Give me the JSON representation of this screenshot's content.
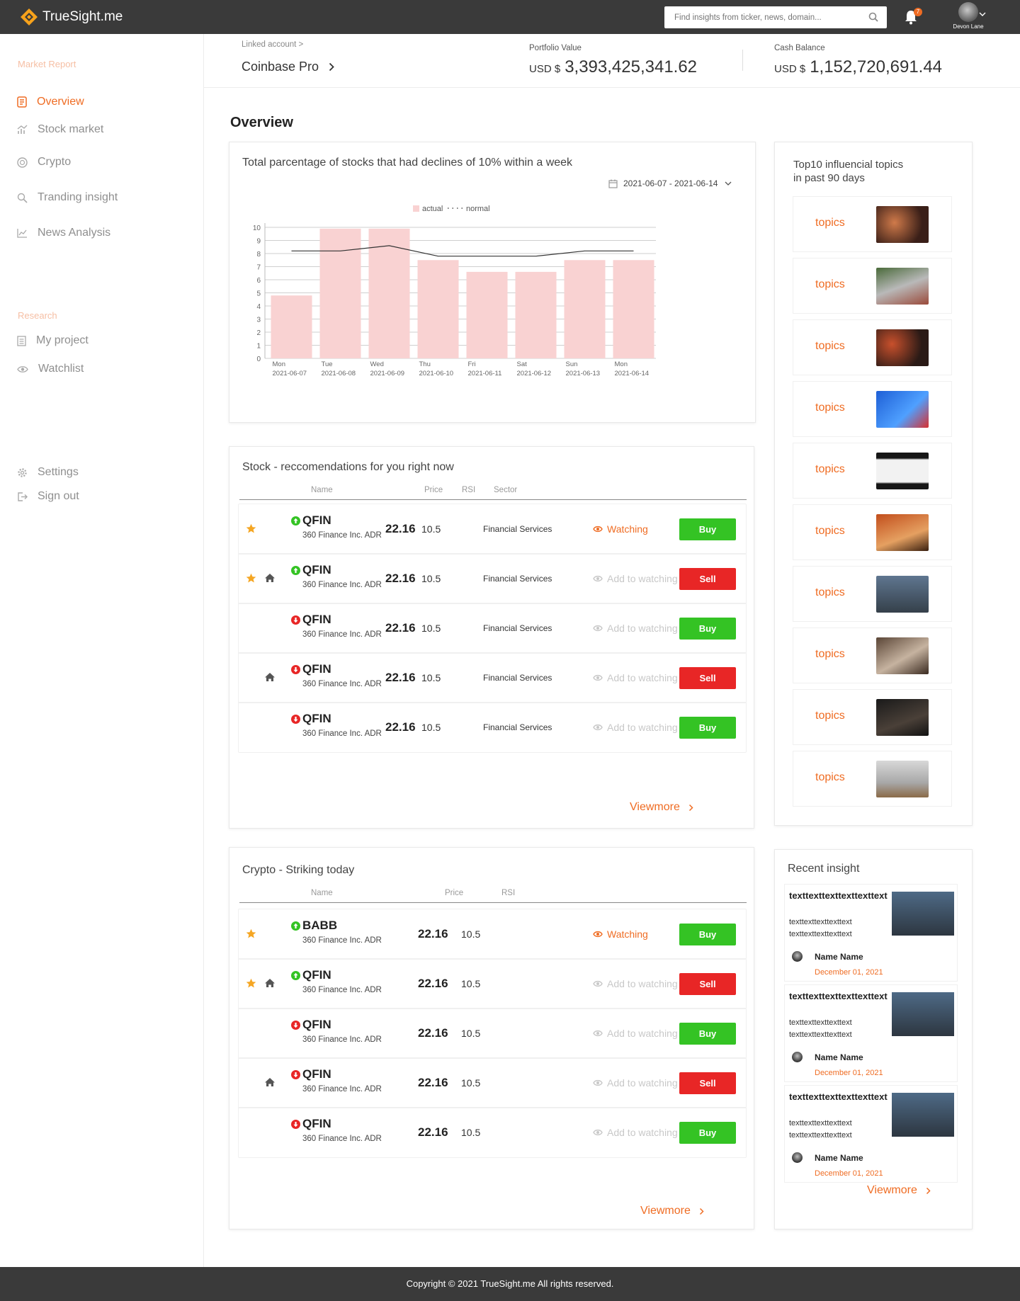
{
  "app": {
    "name": "TrueSight.me"
  },
  "header": {
    "search_placeholder": "Find insights from ticker, news, domain...",
    "notification_count": "7",
    "user_name": "Devon Lane"
  },
  "sidebar": {
    "market_label": "Market Report",
    "market_items": [
      {
        "label": "Overview",
        "icon": "overview-icon",
        "active": true
      },
      {
        "label": "Stock market",
        "icon": "stock-chart-icon"
      },
      {
        "label": "Crypto",
        "icon": "crypto-icon"
      },
      {
        "label": "Tranding insight",
        "icon": "search-insight-icon"
      },
      {
        "label": "News Analysis",
        "icon": "line-chart-icon"
      }
    ],
    "research_label": "Research",
    "research_items": [
      {
        "label": "My project",
        "icon": "project-icon"
      },
      {
        "label": "Watchlist",
        "icon": "eye-icon"
      }
    ],
    "bottom_items": [
      {
        "label": "Settings",
        "icon": "gear-icon"
      },
      {
        "label": "Sign out",
        "icon": "sign-out-icon"
      }
    ]
  },
  "account": {
    "linked_label": "Linked account >",
    "linked_value": "Coinbase Pro",
    "portfolio_label": "Portfolio Value",
    "portfolio_currency": "USD $",
    "portfolio_value": "3,393,425,341.62",
    "cash_label": "Cash Balance",
    "cash_currency": "USD $",
    "cash_value": "1,152,720,691.44"
  },
  "page": {
    "title": "Overview"
  },
  "decline_card": {
    "title": "Total parcentage of stocks that had declines of 10% within a week",
    "date_range": "2021-06-07 - 2021-06-14"
  },
  "chart_data": {
    "type": "bar",
    "title": "Total parcentage of stocks that had declines of 10% within a week",
    "legend": [
      "actual",
      "normal"
    ],
    "legend_position": "top-center",
    "days": [
      "Mon",
      "Tue",
      "Wed",
      "Thu",
      "Fri",
      "Sat",
      "Sun",
      "Mon"
    ],
    "categories": [
      "2021-06-07",
      "2021-06-08",
      "2021-06-09",
      "2021-06-10",
      "2021-06-11",
      "2021-06-12",
      "2021-06-13",
      "2021-06-14"
    ],
    "series": [
      {
        "name": "actual",
        "type": "bar",
        "values": [
          4.8,
          9.9,
          9.9,
          7.5,
          6.6,
          6.6,
          7.5,
          7.5
        ]
      },
      {
        "name": "normal",
        "type": "line",
        "values": [
          8.2,
          8.2,
          8.6,
          7.8,
          7.8,
          7.8,
          8.2,
          8.2
        ]
      }
    ],
    "ylim": [
      0,
      10
    ],
    "yticks": [
      0,
      1,
      2,
      3,
      4,
      5,
      6,
      7,
      8,
      9,
      10
    ],
    "grid": true,
    "colors": {
      "bar": "#f9d2d2",
      "line": "#333333"
    }
  },
  "stock_card": {
    "title": "Stock - reccomendations for you right now",
    "headers": {
      "name": "Name",
      "price": "Price",
      "rsi": "RSI",
      "sector": "Sector"
    },
    "rows": [
      {
        "ticker": "QFIN",
        "company": "360 Finance Inc. ADR",
        "price": "22.16",
        "rsi": "10.5",
        "sector": "Financial Services",
        "watch": "Watching",
        "action": "Buy"
      },
      {
        "ticker": "QFIN",
        "company": "360 Finance Inc. ADR",
        "price": "22.16",
        "rsi": "10.5",
        "sector": "Financial Services",
        "watch": "Add to watching",
        "action": "Sell"
      },
      {
        "ticker": "QFIN",
        "company": "360 Finance Inc. ADR",
        "price": "22.16",
        "rsi": "10.5",
        "sector": "Financial Services",
        "watch": "Add to watching",
        "action": "Buy"
      },
      {
        "ticker": "QFIN",
        "company": "360 Finance Inc. ADR",
        "price": "22.16",
        "rsi": "10.5",
        "sector": "Financial Services",
        "watch": "Add to watching",
        "action": "Sell"
      },
      {
        "ticker": "QFIN",
        "company": "360 Finance Inc. ADR",
        "price": "22.16",
        "rsi": "10.5",
        "sector": "Financial Services",
        "watch": "Add to watching",
        "action": "Buy"
      }
    ],
    "viewmore": "Viewmore"
  },
  "crypto_card": {
    "title": "Crypto - Striking today",
    "headers": {
      "name": "Name",
      "price": "Price",
      "rsi": "RSI"
    },
    "rows": [
      {
        "ticker": "BABB",
        "company": "360 Finance Inc. ADR",
        "price": "22.16",
        "rsi": "10.5",
        "watch": "Watching",
        "action": "Buy"
      },
      {
        "ticker": "QFIN",
        "company": "360 Finance Inc. ADR",
        "price": "22.16",
        "rsi": "10.5",
        "watch": "Add to watching",
        "action": "Sell"
      },
      {
        "ticker": "QFIN",
        "company": "360 Finance Inc. ADR",
        "price": "22.16",
        "rsi": "10.5",
        "watch": "Add to watching",
        "action": "Buy"
      },
      {
        "ticker": "QFIN",
        "company": "360 Finance Inc. ADR",
        "price": "22.16",
        "rsi": "10.5",
        "watch": "Add to watching",
        "action": "Sell"
      },
      {
        "ticker": "QFIN",
        "company": "360 Finance Inc. ADR",
        "price": "22.16",
        "rsi": "10.5",
        "watch": "Add to watching",
        "action": "Buy"
      }
    ],
    "viewmore": "Viewmore"
  },
  "topics_card": {
    "title_line1": "Top10 influencial topics",
    "title_line2": "in past 90 days",
    "topics": [
      "topics",
      "topics",
      "topics",
      "topics",
      "topics",
      "topics",
      "topics",
      "topics",
      "topics",
      "topics"
    ]
  },
  "insight_card": {
    "title": "Recent insight",
    "items": [
      {
        "title": "texttexttexttexttexttext",
        "body": "texttexttexttexttext texttexttexttexttext",
        "author": "Name Name",
        "date": "December 01, 2021"
      },
      {
        "title": "texttexttexttexttexttext",
        "body": "texttexttexttexttext texttexttexttexttext",
        "author": "Name Name",
        "date": "December 01, 2021"
      },
      {
        "title": "texttexttexttexttexttext",
        "body": "texttexttexttexttext texttexttexttexttext",
        "author": "Name Name",
        "date": "December 01, 2021"
      }
    ],
    "viewmore": "Viewmore"
  },
  "colors": {
    "accent": "#ef6c23",
    "buy": "#34c324",
    "sell": "#e82626",
    "topbar": "#3a3a3a",
    "star": "#f5a623"
  },
  "footer": {
    "text": "Copyright © 2021 TrueSight.me All rights reserved."
  }
}
